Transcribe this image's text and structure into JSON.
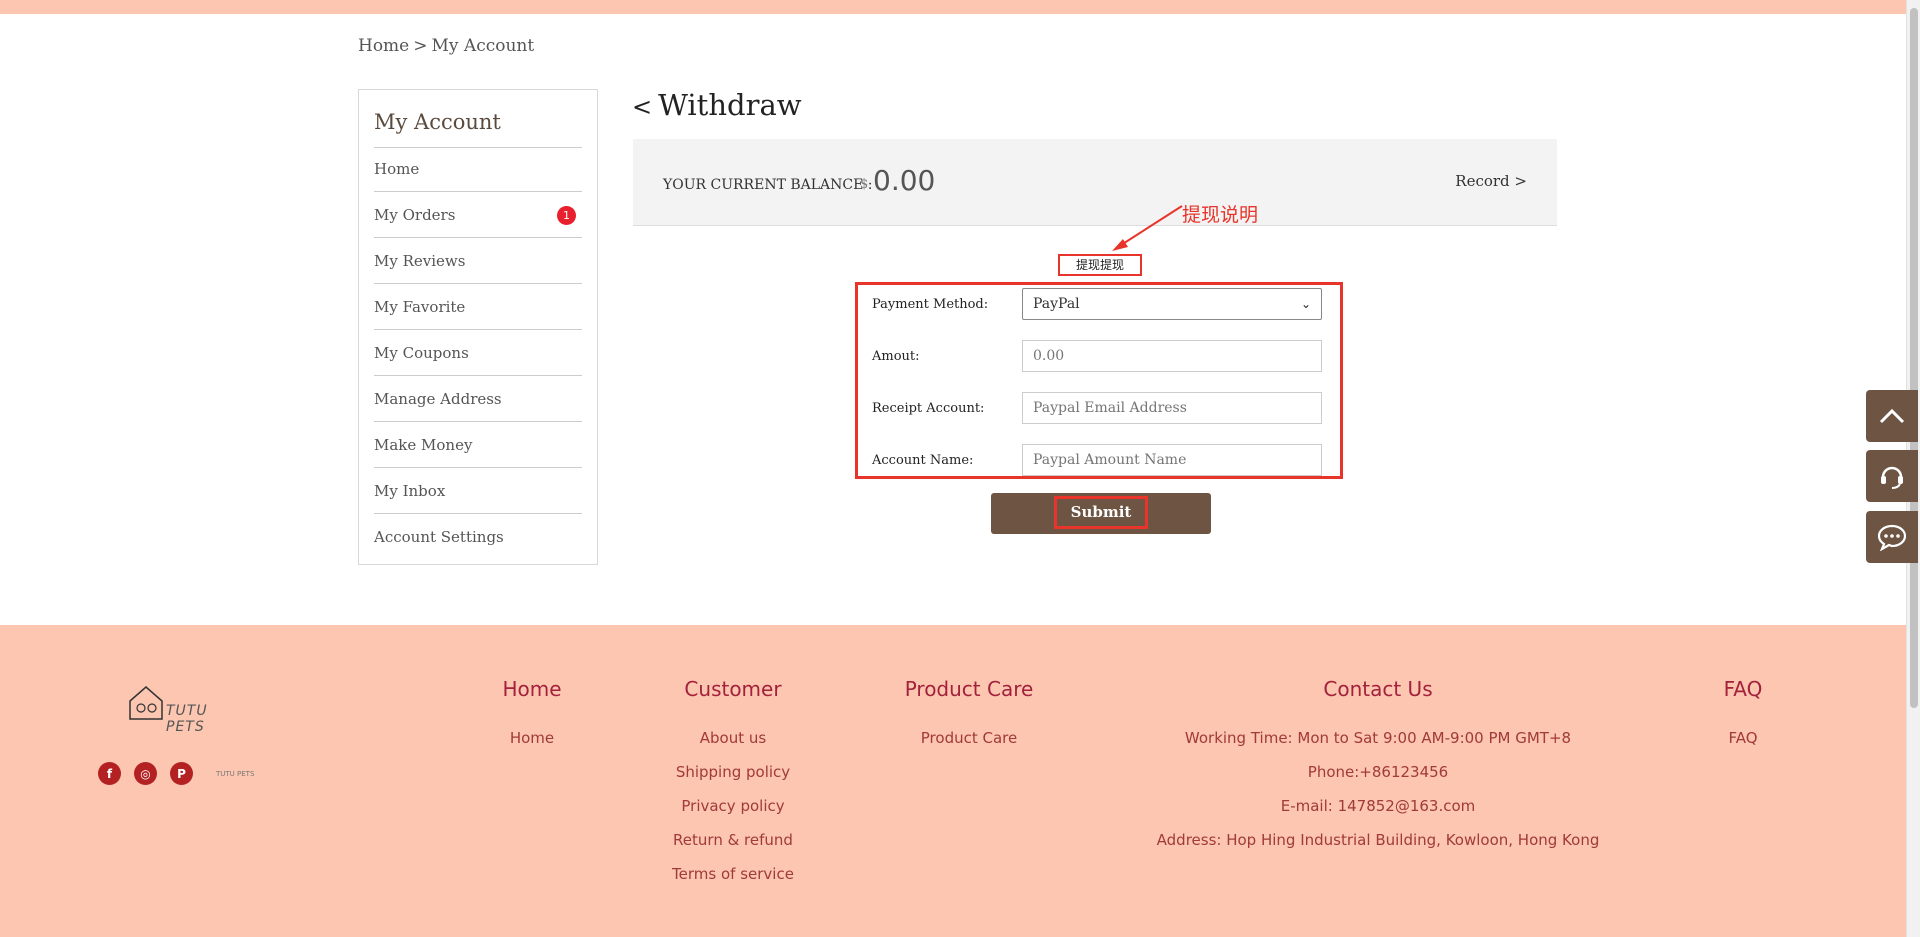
{
  "breadcrumb": {
    "home": "Home",
    "sep": ">",
    "current": "My Account"
  },
  "sidebar": {
    "title": "My Account",
    "items": [
      {
        "label": "Home"
      },
      {
        "label": "My Orders",
        "badge": "1"
      },
      {
        "label": "My Reviews"
      },
      {
        "label": "My Favorite"
      },
      {
        "label": "My Coupons"
      },
      {
        "label": "Manage Address"
      },
      {
        "label": "Make Money"
      },
      {
        "label": "My Inbox"
      },
      {
        "label": "Account Settings"
      }
    ]
  },
  "page": {
    "back": "<",
    "title": "Withdraw"
  },
  "balance": {
    "label": "YOUR CURRENT BALANCE :",
    "currency": "$",
    "amount": "0.00",
    "record": "Record >"
  },
  "annotation": {
    "label": "提现说明",
    "small_box": "提现提现",
    "color": "#e8342a"
  },
  "form": {
    "payment_method": {
      "label": "Payment Method:",
      "value": "PayPal",
      "options": [
        "PayPal"
      ]
    },
    "amount": {
      "label": "Amout:",
      "placeholder": "0.00"
    },
    "receipt_account": {
      "label": "Receipt Account:",
      "placeholder": "Paypal Email Address"
    },
    "account_name": {
      "label": "Account Name:",
      "placeholder": "Paypal Amount Name"
    },
    "submit": "Submit"
  },
  "float_buttons": [
    "chevron-up-icon",
    "headset-icon",
    "chat-icon"
  ],
  "footer": {
    "logo_text": "TUTU PETS",
    "socials": [
      "facebook-icon",
      "instagram-icon",
      "pinterest-icon"
    ],
    "mini_logo": "TUTU PETS",
    "columns": {
      "home": {
        "title": "Home",
        "links": [
          "Home"
        ]
      },
      "customer": {
        "title": "Customer",
        "links": [
          "About us",
          "Shipping policy",
          "Privacy policy",
          "Return & refund",
          "Terms of service"
        ]
      },
      "product_care": {
        "title": "Product Care",
        "links": [
          "Product Care"
        ]
      },
      "contact": {
        "title": "Contact Us",
        "lines": [
          "Working Time: Mon to Sat 9:00 AM-9:00 PM GMT+8",
          "Phone:+86123456",
          "E-mail: 147852@163.com",
          "Address: Hop Hing Industrial Building, Kowloon, Hong Kong"
        ]
      },
      "faq": {
        "title": "FAQ",
        "links": [
          "FAQ"
        ]
      }
    }
  },
  "colors": {
    "brand_brown": "#6e5443",
    "footer_bg": "#fcc6b0",
    "footer_title": "#a3213d",
    "badge_red": "#e8202e"
  }
}
